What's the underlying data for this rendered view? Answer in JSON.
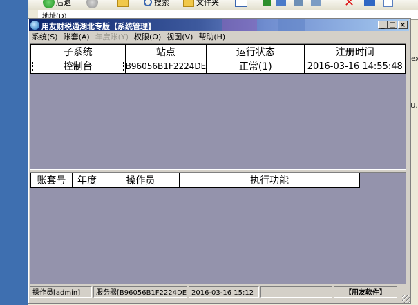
{
  "background": {
    "toolbar_items": [
      "后退",
      "搜索",
      "文件夹"
    ],
    "address_label": "地址(D)",
    "right_text_1": "ex",
    "right_text_2": "U.."
  },
  "window": {
    "title": "用友财税通湖北专版【系统管理】",
    "btn_min": "_",
    "btn_max": "□",
    "btn_close": "×"
  },
  "menu": [
    "系统(S)",
    "账套(A)",
    "年度账(Y)",
    "权限(O)",
    "视图(V)",
    "帮助(H)"
  ],
  "top_table": {
    "headers": [
      "子系统",
      "站点",
      "运行状态",
      "注册时间"
    ],
    "rows": [
      [
        "控制台",
        "B96056B1F2224DE",
        "正常(1)",
        "2016-03-16 14:55:48"
      ]
    ]
  },
  "bottom_table": {
    "headers": [
      "账套号",
      "年度",
      "操作员",
      "执行功能"
    ]
  },
  "status": {
    "operator": "操作员[admin]",
    "server": "服务器[B96056B1F2224DE]",
    "datetime": "2016-03-16 15:12",
    "brand": "【用友软件】"
  },
  "colors": {
    "pane_bg": "#9493ac",
    "title_start": "#0a246a",
    "title_end": "#a6caf0"
  }
}
